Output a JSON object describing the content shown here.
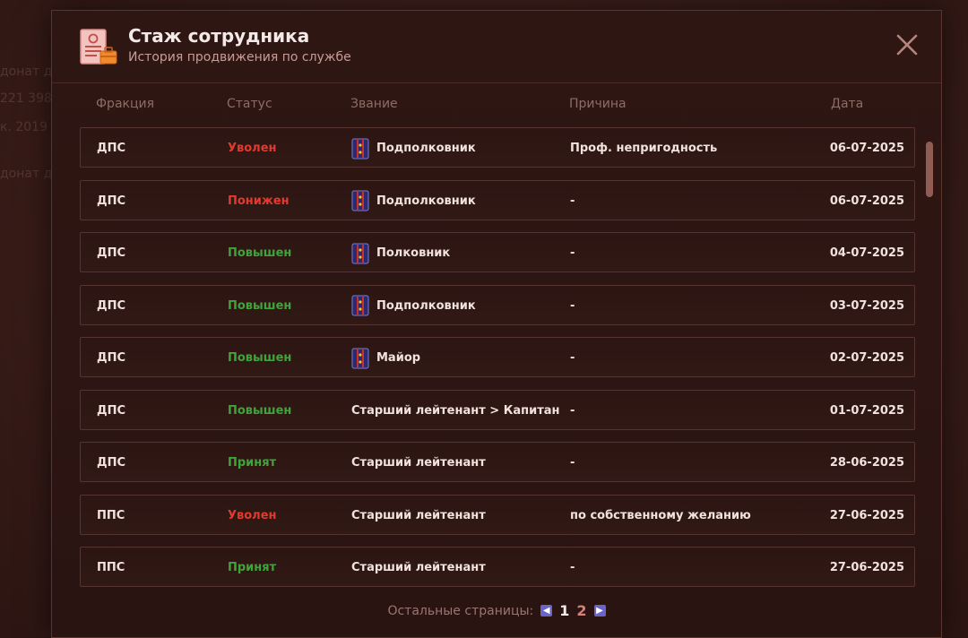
{
  "background_texts": [
    "донат д",
    "221 398",
    "к. 2019",
    "донат д"
  ],
  "modal": {
    "title": "Стаж сотрудника",
    "subtitle": "История продвижения по службе"
  },
  "columns": {
    "faction": "Фракция",
    "status": "Статус",
    "rank": "Звание",
    "reason": "Причина",
    "date": "Дата"
  },
  "colors": {
    "status_red": "#e23a2e",
    "status_green": "#3fa43a",
    "pager_arrow": "#6a63c9"
  },
  "rows": [
    {
      "faction": "ДПС",
      "status": "Уволен",
      "status_color": "red",
      "rank": "Подполковник",
      "rank_icon": "shoulder-strap-icon",
      "reason": "Проф. непригодность",
      "date": "06-07-2025"
    },
    {
      "faction": "ДПС",
      "status": "Понижен",
      "status_color": "red",
      "rank": "Подполковник",
      "rank_icon": "shoulder-strap-icon",
      "reason": "-",
      "date": "06-07-2025"
    },
    {
      "faction": "ДПС",
      "status": "Повышен",
      "status_color": "green",
      "rank": "Полковник",
      "rank_icon": "shoulder-strap-icon",
      "reason": "-",
      "date": "04-07-2025"
    },
    {
      "faction": "ДПС",
      "status": "Повышен",
      "status_color": "green",
      "rank": "Подполковник",
      "rank_icon": "shoulder-strap-icon",
      "reason": "-",
      "date": "03-07-2025"
    },
    {
      "faction": "ДПС",
      "status": "Повышен",
      "status_color": "green",
      "rank": "Майор",
      "rank_icon": "shoulder-strap-icon",
      "reason": "-",
      "date": "02-07-2025"
    },
    {
      "faction": "ДПС",
      "status": "Повышен",
      "status_color": "green",
      "rank": "Старший лейтенант > Капитан",
      "rank_icon": null,
      "reason": "-",
      "date": "01-07-2025"
    },
    {
      "faction": "ДПС",
      "status": "Принят",
      "status_color": "green",
      "rank": "Старший лейтенант",
      "rank_icon": null,
      "reason": "-",
      "date": "28-06-2025"
    },
    {
      "faction": "ППС",
      "status": "Уволен",
      "status_color": "red",
      "rank": "Старший лейтенант",
      "rank_icon": null,
      "reason": "по собственному желанию",
      "date": "27-06-2025"
    },
    {
      "faction": "ППС",
      "status": "Принят",
      "status_color": "green",
      "rank": "Старший лейтенант",
      "rank_icon": null,
      "reason": "-",
      "date": "27-06-2025"
    }
  ],
  "pager": {
    "label": "Остальные страницы:",
    "pages": [
      "1",
      "2"
    ],
    "current": "1",
    "prev_icon": "chevron-left-icon",
    "next_icon": "chevron-right-icon"
  }
}
